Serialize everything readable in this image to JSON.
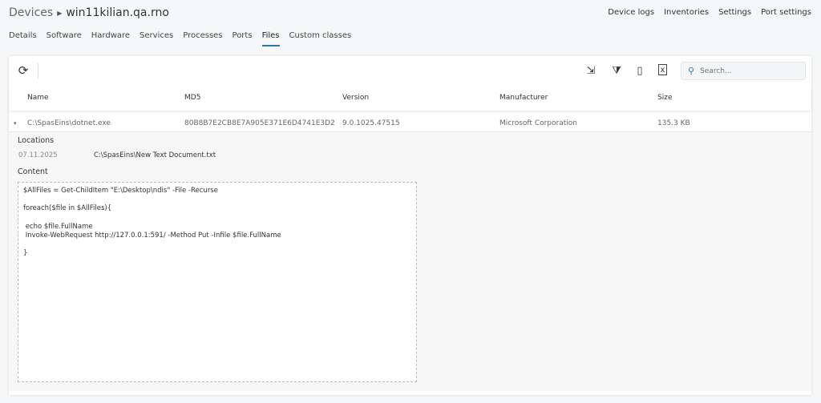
{
  "breadcrumb": {
    "parent": "Devices",
    "current": "win11kilian.qa.rno"
  },
  "top_links": [
    "Device logs",
    "Inventories",
    "Settings",
    "Port settings"
  ],
  "tabs": [
    "Details",
    "Software",
    "Hardware",
    "Services",
    "Processes",
    "Ports",
    "Files",
    "Custom classes"
  ],
  "active_tab": "Files",
  "toolbar": {
    "search_placeholder": "Search...",
    "icons": [
      "refresh-icon",
      "export-icon",
      "clear-filter-icon",
      "columns-icon",
      "excel-export-icon"
    ]
  },
  "table": {
    "columns": [
      "Name",
      "MD5",
      "Version",
      "Manufacturer",
      "Size"
    ],
    "rows": [
      {
        "name": "C:\\SpasEins\\dotnet.exe",
        "md5": "80B8B7E2CB8E7A905E371E6D4741E3D2",
        "version": "9.0.1025.47515",
        "manufacturer": "Microsoft Corporation",
        "size": "135.3 KB"
      }
    ]
  },
  "detail": {
    "locations_label": "Locations",
    "locations": [
      {
        "date": "07.11.2025",
        "path": "C:\\SpasEins\\New Text Document.txt"
      }
    ],
    "content_label": "Content",
    "content": "$AllFiles = Get-ChildItem \"E:\\Desktop\\ndis\" -File -Recurse\n\nforeach($file in $AllFiles){\n\n echo $file.FullName\n Invoke-WebRequest http://127.0.0.1:591/ -Method Put -Infile $file.FullName\n\n}"
  }
}
